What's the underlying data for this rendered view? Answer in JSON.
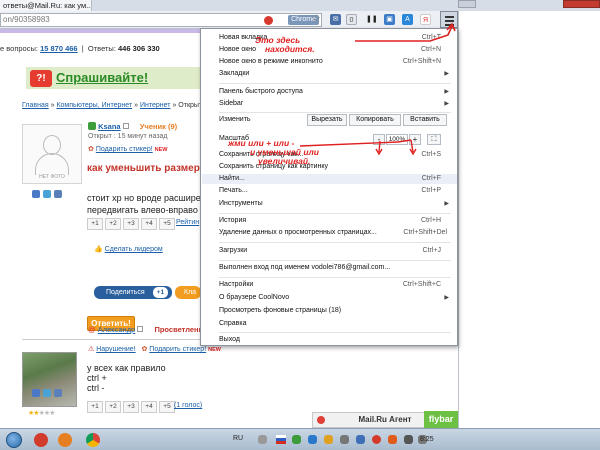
{
  "browser": {
    "tab_title": "ответы@Mail.Ru: как ум...",
    "url": "on/90358983",
    "url_badge": "Chrome",
    "ext_badge_count": "0"
  },
  "site": {
    "question_stats_label": "е вопросы:",
    "question_stats_value": "15 870 466",
    "answers_label": "Ответы:",
    "answers_value": "446 306 330",
    "ask_label": "Спрашивайте!",
    "breadcrumb": [
      "Главная",
      "Компьютеры, Интернет",
      "Интернет",
      "Открытый"
    ],
    "avatar_caption": "НЕТ ФОТО",
    "user_name": "Ksana",
    "user_rank": "Ученик (9)",
    "opened_text": "Открыт : 15 минут назад",
    "sticker_link": "Подарить стикер!",
    "sticker_new": "NEW",
    "question_title": "как уменьшить размер з",
    "question_body": [
      "стоит хр но вроде расширени",
      "передвигать влево-вправо ст"
    ],
    "votes": [
      "+1",
      "+2",
      "+3",
      "+4",
      "+5"
    ],
    "rate_link": "Рейтин",
    "leader_link": "Сделать лидером",
    "share_label": "Поделиться",
    "share_count": "+1",
    "ok_label": "Кла",
    "answer_button": "Ответить!",
    "answer2": {
      "author": "Александр",
      "rank": "Просветленны",
      "violation": "Нарушение!",
      "sticker": "Подарить стикер!",
      "sticker_new": "NEW",
      "text": [
        "у всех как правило",
        "ctrl +",
        "ctrl -"
      ],
      "votes": [
        "+1",
        "+2",
        "+3",
        "+4",
        "+5"
      ],
      "votes_count": "(1 голос)"
    }
  },
  "menu": {
    "items": [
      {
        "label": "Новая вкладка",
        "shortcut": "Ctrl+T"
      },
      {
        "label": "Новое окно",
        "shortcut": "Ctrl+N"
      },
      {
        "label": "Новое окно в режиме инкогнито",
        "shortcut": "Ctrl+Shift+N"
      },
      {
        "label": "Закладки",
        "shortcut": ""
      },
      {
        "label": "Панель быстрого доступа",
        "shortcut": ""
      },
      {
        "label": "Sidebar",
        "shortcut": ""
      }
    ],
    "edit_label": "Изменить",
    "cut": "Вырезать",
    "copy": "Копировать",
    "paste": "Вставить",
    "zoom_label": "Масштаб",
    "zoom_minus": "-",
    "zoom_value": "100%",
    "zoom_plus": "+",
    "items2": [
      {
        "label": "Сохранить страницу как...",
        "shortcut": "Ctrl+S"
      },
      {
        "label": "Сохранить страницу как картинку",
        "shortcut": ""
      },
      {
        "label": "Найти...",
        "shortcut": "Ctrl+F"
      },
      {
        "label": "Печать...",
        "shortcut": "Ctrl+P"
      },
      {
        "label": "Инструменты",
        "shortcut": ""
      },
      {
        "label": "История",
        "shortcut": "Ctrl+H"
      },
      {
        "label": "Удаление данных о просмотренных страницах...",
        "shortcut": "Ctrl+Shift+Del"
      },
      {
        "label": "Загрузки",
        "shortcut": "Ctrl+J"
      },
      {
        "label": "Выполнен вход под именем vodolei786@gmail.com...",
        "shortcut": ""
      },
      {
        "label": "Настройки",
        "shortcut": "Ctrl+Shift+C"
      },
      {
        "label": "О браузере CoolNovo",
        "shortcut": ""
      },
      {
        "label": "Просмотреть фоновые страницы (18)",
        "shortcut": ""
      },
      {
        "label": "Справка",
        "shortcut": ""
      },
      {
        "label": "Выход",
        "shortcut": ""
      }
    ]
  },
  "annotations": {
    "top": [
      "Это здесь",
      "находится."
    ],
    "zoom": [
      "жми или + или -",
      "и уменьшай или",
      "увеличивай."
    ]
  },
  "bottom": {
    "agent_label": "Mail.Ru Агент",
    "flybar": "flybar"
  },
  "taskbar": {
    "lang": "RU",
    "clock": "8:25"
  }
}
